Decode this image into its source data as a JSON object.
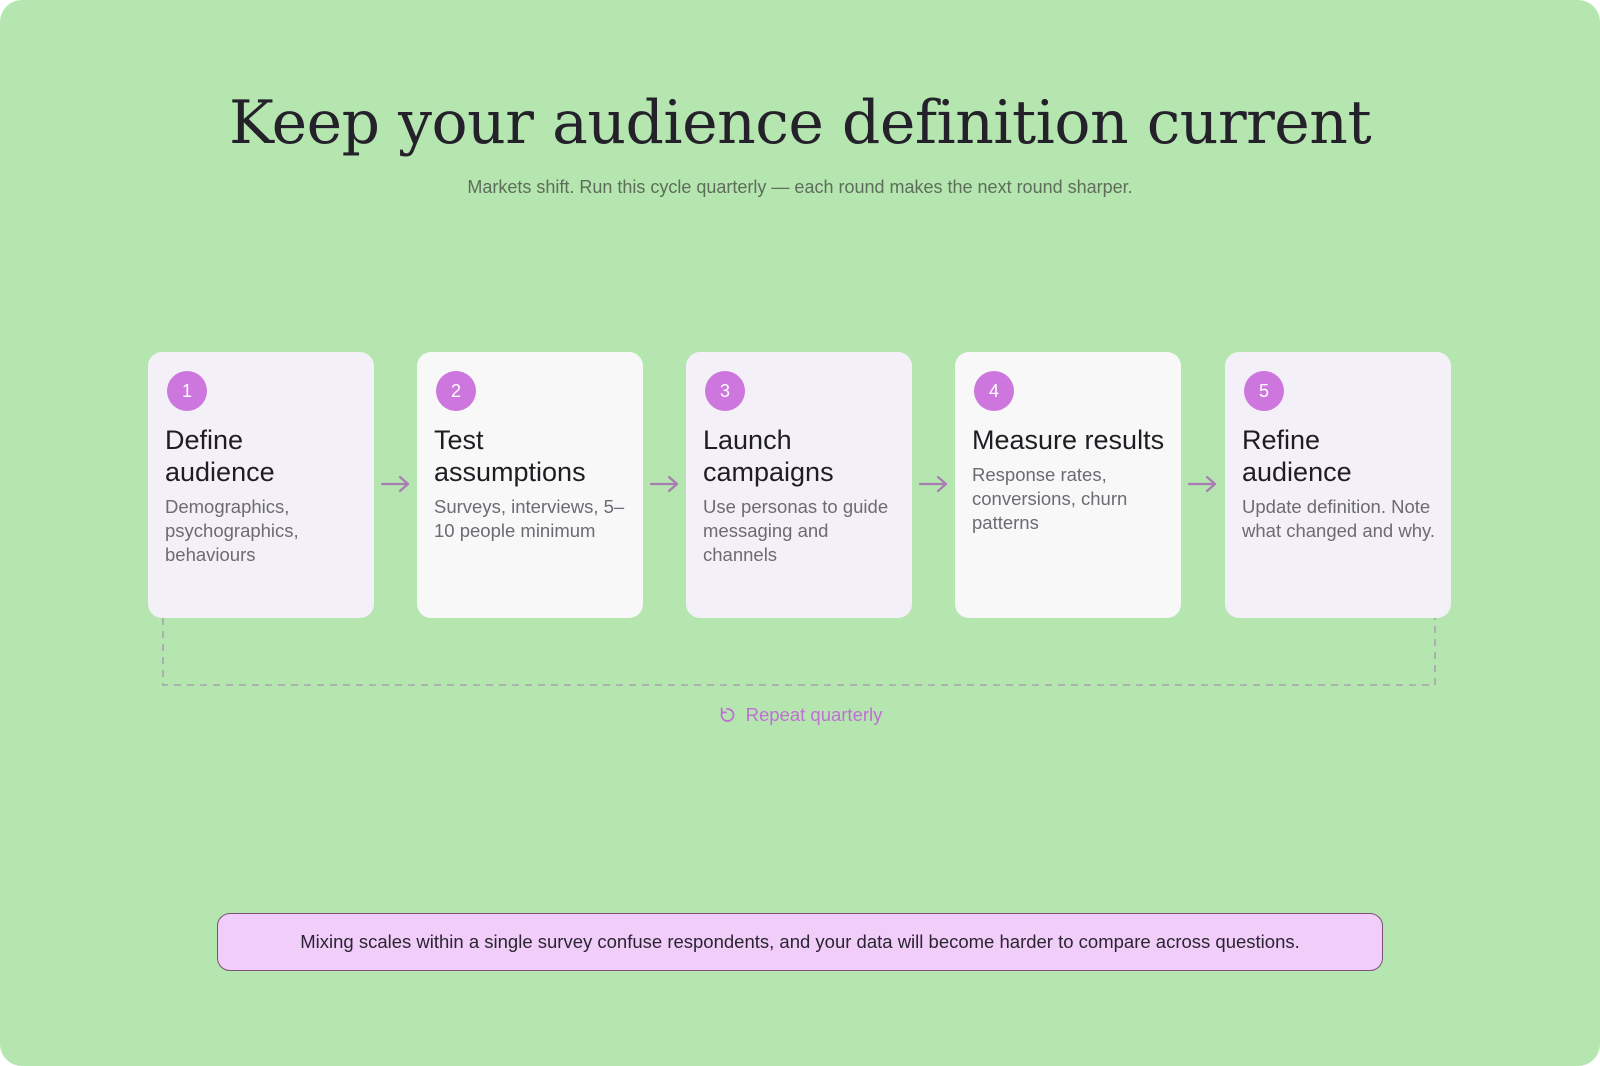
{
  "header": {
    "title": "Keep your audience definition current",
    "subtitle": "Markets shift. Run this cycle quarterly — each round makes the next round sharper."
  },
  "steps": [
    {
      "number": "1",
      "title": "Define audience",
      "description": "Demographics, psychographics, behaviours"
    },
    {
      "number": "2",
      "title": "Test assumptions",
      "description": "Surveys, interviews, 5–10 people minimum"
    },
    {
      "number": "3",
      "title": "Launch campaigns",
      "description": "Use personas to guide messaging and channels"
    },
    {
      "number": "4",
      "title": "Measure results",
      "description": "Response rates, conversions, churn patterns"
    },
    {
      "number": "5",
      "title": "Refine audience",
      "description": "Update definition. Note what changed and why."
    }
  ],
  "loop": {
    "label": "Repeat quarterly",
    "icon": "refresh-icon"
  },
  "note": {
    "text": "Mixing scales within a single survey confuse respondents, and your data will become harder to compare across questions."
  },
  "colors": {
    "background": "#b5e6b0",
    "accent": "#cd76de",
    "arrow": "#a97cb4",
    "note_background": "#f1cdfa"
  }
}
